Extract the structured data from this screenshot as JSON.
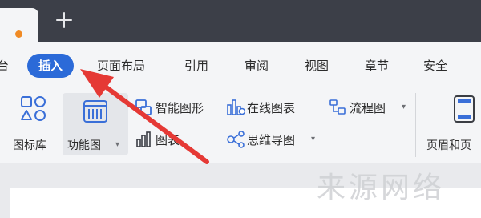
{
  "tabbar": {
    "new_tab_icon": "plus-icon",
    "unsaved_dot_color": "#f08a24"
  },
  "menu": {
    "items": [
      {
        "label": "台"
      },
      {
        "label": "插入"
      },
      {
        "label": "页面布局"
      },
      {
        "label": "引用"
      },
      {
        "label": "审阅"
      },
      {
        "label": "视图"
      },
      {
        "label": "章节"
      },
      {
        "label": "安全"
      }
    ],
    "active_color": "#2b6ad8"
  },
  "ribbon": {
    "icon_library": "图标库",
    "function_chart": "功能图",
    "smart_shape": "智能图形",
    "online_chart": "在线图表",
    "flowchart": "流程图",
    "chart": "图表",
    "mindmap": "思维导图",
    "header_footer": "页眉和页"
  },
  "watermark": "来源网络",
  "annotation": {
    "arrow_color": "#e53935"
  }
}
